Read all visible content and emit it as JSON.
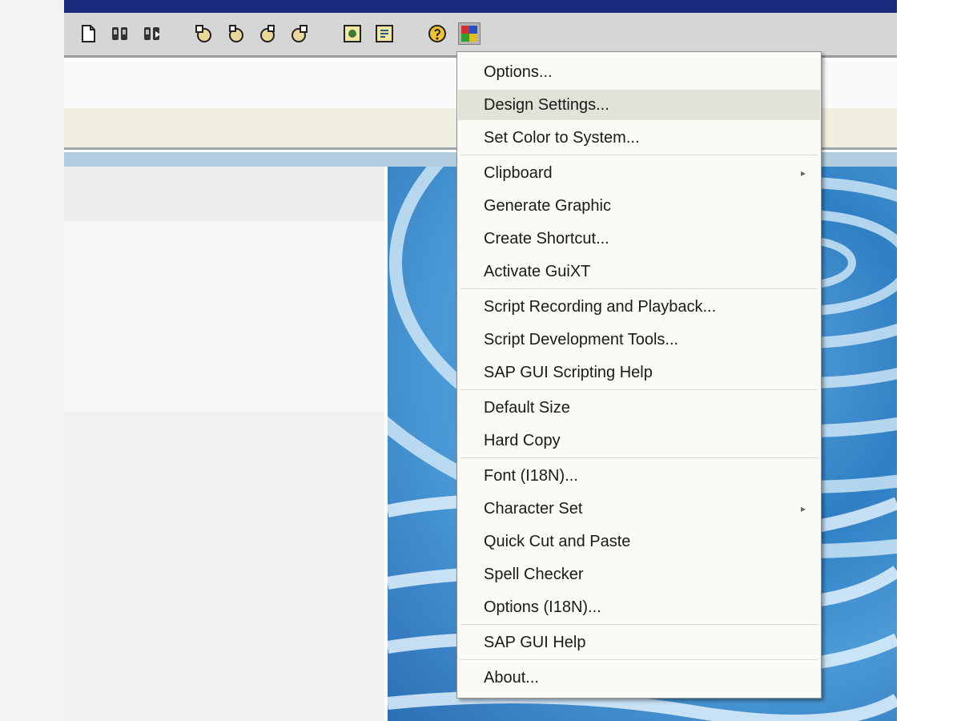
{
  "context_menu": {
    "items": [
      {
        "label": "Options..."
      },
      {
        "label": "Design Settings..."
      },
      {
        "label": "Set Color to System..."
      },
      {
        "label": "Clipboard",
        "arrow": "▸"
      },
      {
        "label": "Generate Graphic"
      },
      {
        "label": "Create Shortcut..."
      },
      {
        "label": "Activate GuiXT"
      },
      {
        "label": "Script Recording and Playback..."
      },
      {
        "label": "Script Development Tools..."
      },
      {
        "label": "SAP GUI Scripting Help"
      },
      {
        "label": "Default Size"
      },
      {
        "label": "Hard Copy"
      },
      {
        "label": "Font (I18N)..."
      },
      {
        "label": "Character Set",
        "arrow": "▸"
      },
      {
        "label": "Quick Cut and Paste"
      },
      {
        "label": "Spell Checker"
      },
      {
        "label": "Options (I18N)..."
      },
      {
        "label": "SAP GUI Help"
      },
      {
        "label": "About..."
      }
    ]
  },
  "toolbar": {
    "icons": [
      "new-session-icon",
      "find-icon",
      "find-next-icon",
      "first-page-icon",
      "previous-page-icon",
      "next-page-icon",
      "last-page-icon",
      "create-shortcut-icon",
      "layout-icon",
      "help-icon",
      "customize-layout-icon"
    ]
  },
  "colors": {
    "title_bar": "#1c2a7e",
    "toolbar": "#d6d6d6",
    "menu_background": "#fbfbf6",
    "menu_hover": "#e2e2d8"
  }
}
